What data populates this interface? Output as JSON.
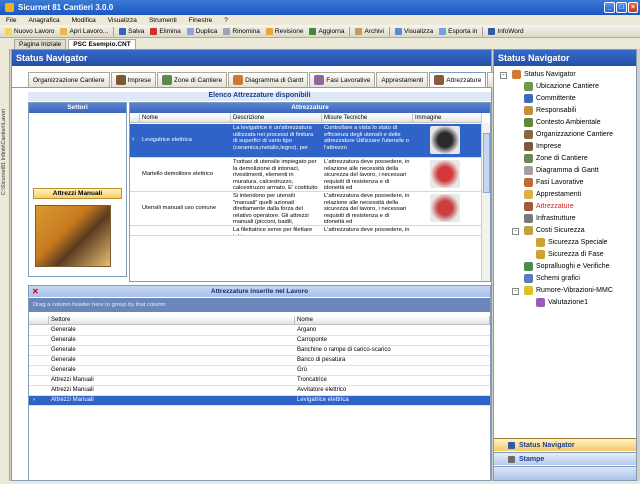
{
  "window": {
    "title": "Sicurnet 81 Cantieri 3.0.0"
  },
  "menu": [
    "File",
    "Anagrafica",
    "Modifica",
    "Visualizza",
    "Strumenti",
    "Finestre",
    "?"
  ],
  "toolbar": [
    {
      "label": "Nuovo Lavoro",
      "icon": "new-doc-icon",
      "color": "#f5d65a"
    },
    {
      "label": "Apri Lavoro...",
      "icon": "open-folder-icon",
      "color": "#e7b84a"
    },
    {
      "label": "Salva",
      "icon": "save-icon",
      "color": "#3563b5"
    },
    {
      "label": "Elimina",
      "icon": "delete-icon",
      "color": "#d32e2e"
    },
    {
      "label": "Duplica",
      "icon": "duplicate-icon",
      "color": "#8aa5d8"
    },
    {
      "label": "Rinomina",
      "icon": "rename-icon",
      "color": "#9aa6b8"
    },
    {
      "label": "Revisione",
      "icon": "revision-icon",
      "color": "#e3a93a"
    },
    {
      "label": "Aggiorna",
      "icon": "refresh-icon",
      "color": "#3c8b3c"
    },
    {
      "label": "Archivi",
      "icon": "archive-icon",
      "color": "#c99b52"
    },
    {
      "label": "Visualizza",
      "icon": "view-icon",
      "color": "#5a8bd6"
    },
    {
      "label": "Esporta in",
      "icon": "export-icon",
      "color": "#6fa0e0"
    },
    {
      "label": "InfoWord",
      "icon": "word-icon",
      "color": "#2f5ca8"
    }
  ],
  "doc_tabs": [
    {
      "label": "Pagina Iniziale",
      "active": false
    },
    {
      "label": "PSC Esempio.CNT",
      "active": true
    }
  ],
  "side_strip": {
    "label": "C:\\Sicurnet81 Infiniti\\Cantieri\\Lavori"
  },
  "main": {
    "title": "Status Navigator",
    "section_tabs": [
      {
        "label": "Organizzazione Cantiere",
        "icon": "",
        "active": false
      },
      {
        "label": "Imprese",
        "icon": "company-icon",
        "active": false
      },
      {
        "label": "Zone di Cantiere",
        "icon": "zone-icon",
        "active": false
      },
      {
        "label": "Diagramma di Gantt",
        "icon": "gantt-icon",
        "active": false
      },
      {
        "label": "Fasi Lavorative",
        "icon": "phases-icon",
        "active": false
      },
      {
        "label": "Apprestamenti",
        "icon": "",
        "active": false
      },
      {
        "label": "Attrezzature",
        "icon": "tools-icon",
        "active": true
      },
      {
        "label": "Infr",
        "icon": "",
        "active": false
      }
    ],
    "elenco_title": "Elenco Attrezzature disponibili",
    "settori": {
      "header": "Settori",
      "selected": "Attrezzi Manuali"
    },
    "attrezzature": {
      "header": "Attrezzature",
      "columns": [
        "Nome",
        "Descrizione",
        "Misure Tecniche",
        "Immagine"
      ],
      "rows": [
        {
          "nome": "Levigatrice elettrica",
          "descrizione": "La levigatrice è un'attrezzatura utilizzata nei processi di finitura di superfici di vario tipo (ceramica,metallo,legno), per",
          "misure": "Controllare a vista lo stato di efficienza degli utensili e delle attrezzature Utilizzare l'utensile o l'attrezzo",
          "selected": true
        },
        {
          "nome": "Martello demolitore elettrico",
          "descrizione": "Trattasi di utensile impiegato per la demolizione di intonaci, rivestimenti, elementi in muratura, calcestruzzo, calcestruzzo armato. E' costituito",
          "misure": "L'attrezzatura deve possedere, in relazione alle necessità della sicurezza del lavoro, i necessari requisiti di resistenza e di idoneità ed",
          "selected": false
        },
        {
          "nome": "Utensili manuali uso comune",
          "descrizione": "Si intendono per utensili \"manuali\" quelli azionati direttamente dalla forza del relativo operatore. Gli attrezzi manuali (picconi, badili,",
          "misure": "L'attrezzatura deve possedere, in relazione alle necessità della sicurezza del lavoro, i necessari requisiti di resistenza e di idoneità ed",
          "selected": false
        },
        {
          "nome": "",
          "descrizione": "La filettatrice serve per filettare tubi",
          "misure": "L'attrezzatura deve possedere, in",
          "selected": false
        }
      ]
    },
    "inserite": {
      "header": "Attrezzature inserite nel Lavoro",
      "groupby": "Drag a column header here to group by that column",
      "columns": [
        "Settore",
        "Nome"
      ],
      "rows": [
        {
          "settore": "Generale",
          "nome": "Argano",
          "selected": false
        },
        {
          "settore": "Generale",
          "nome": "Carroponte",
          "selected": false
        },
        {
          "settore": "Generale",
          "nome": "Banchine o rampe di carico-scarico",
          "selected": false
        },
        {
          "settore": "Generale",
          "nome": "Banco di pesatura",
          "selected": false
        },
        {
          "settore": "Generale",
          "nome": "Grù",
          "selected": false
        },
        {
          "settore": "Attrezzi Manuali",
          "nome": "Troncatrice",
          "selected": false
        },
        {
          "settore": "Attrezzi Manuali",
          "nome": "Avvitatore elettrico",
          "selected": false
        },
        {
          "settore": "Attrezzi Manuali",
          "nome": "Levigatrice elettrica",
          "selected": true
        }
      ]
    }
  },
  "navigator": {
    "title": "Status Navigator",
    "tree": [
      {
        "label": "Status Navigator",
        "level": 0,
        "icon": "navigator-icon",
        "expander": "-"
      },
      {
        "label": "Ubicazione Cantiere",
        "level": 1,
        "icon": "location-icon"
      },
      {
        "label": "Committente",
        "level": 1,
        "icon": "person-icon"
      },
      {
        "label": "Responsabili",
        "level": 1,
        "icon": "responsible-icon"
      },
      {
        "label": "Contesto Ambientale",
        "level": 1,
        "icon": "environment-icon"
      },
      {
        "label": "Organizzazione Cantiere",
        "level": 1,
        "icon": "organization-icon"
      },
      {
        "label": "Imprese",
        "level": 1,
        "icon": "company-icon"
      },
      {
        "label": "Zone di Cantiere",
        "level": 1,
        "icon": "zone-icon"
      },
      {
        "label": "Diagramma di Gantt",
        "level": 1,
        "icon": "gantt-icon"
      },
      {
        "label": "Fasi Lavorative",
        "level": 1,
        "icon": "phases-icon"
      },
      {
        "label": "Apprestamenti",
        "level": 1,
        "icon": "provisions-icon"
      },
      {
        "label": "Attrezzature",
        "level": 1,
        "icon": "tools-icon",
        "highlight": true
      },
      {
        "label": "Infrastrutture",
        "level": 1,
        "icon": "infrastructure-icon"
      },
      {
        "label": "Costi Sicurezza",
        "level": 1,
        "icon": "costs-icon",
        "expander": "-"
      },
      {
        "label": "Sicurezza Speciale",
        "level": 2,
        "icon": "coin-icon"
      },
      {
        "label": "Sicurezza di Fase",
        "level": 2,
        "icon": "coin-icon"
      },
      {
        "label": "Sopralluoghi e Verifiche",
        "level": 1,
        "icon": "inspection-icon"
      },
      {
        "label": "Schemi grafici",
        "level": 1,
        "icon": "schema-icon"
      },
      {
        "label": "Rumore-Vibrazioni-MMC",
        "level": 1,
        "icon": "warning-icon",
        "expander": "-"
      },
      {
        "label": "Valutazione1",
        "level": 2,
        "icon": "evaluation-icon"
      }
    ],
    "bottom_buttons": [
      "Status Navigator",
      "Stampe"
    ]
  },
  "colors": {
    "title_bar": "#1c55c5",
    "panel_header": "#2450a8",
    "selection": "#3063c8",
    "highlight_text": "#d02020"
  }
}
